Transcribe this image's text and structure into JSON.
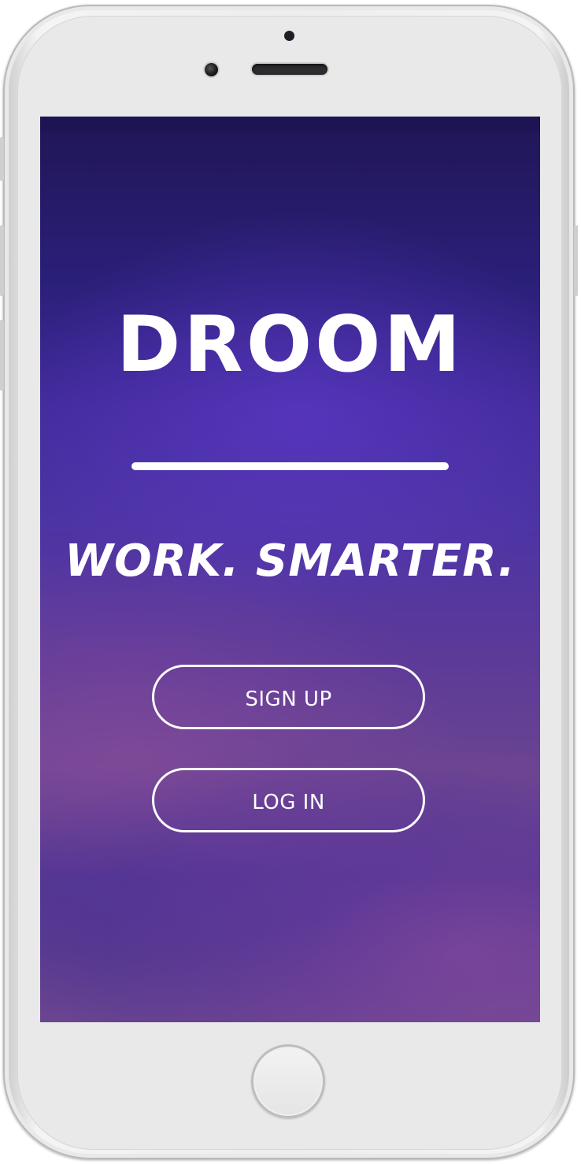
{
  "app": {
    "brand": "DROOM",
    "tagline": "WORK. SMARTER."
  },
  "actions": {
    "signup_label": "SIGN UP",
    "login_label": "LOG IN"
  },
  "colors": {
    "background_top": "#201656",
    "background_mid": "#4d34a4",
    "background_bottom": "#6b4590",
    "foreground": "#ffffff",
    "device_frame": "#ededed"
  }
}
